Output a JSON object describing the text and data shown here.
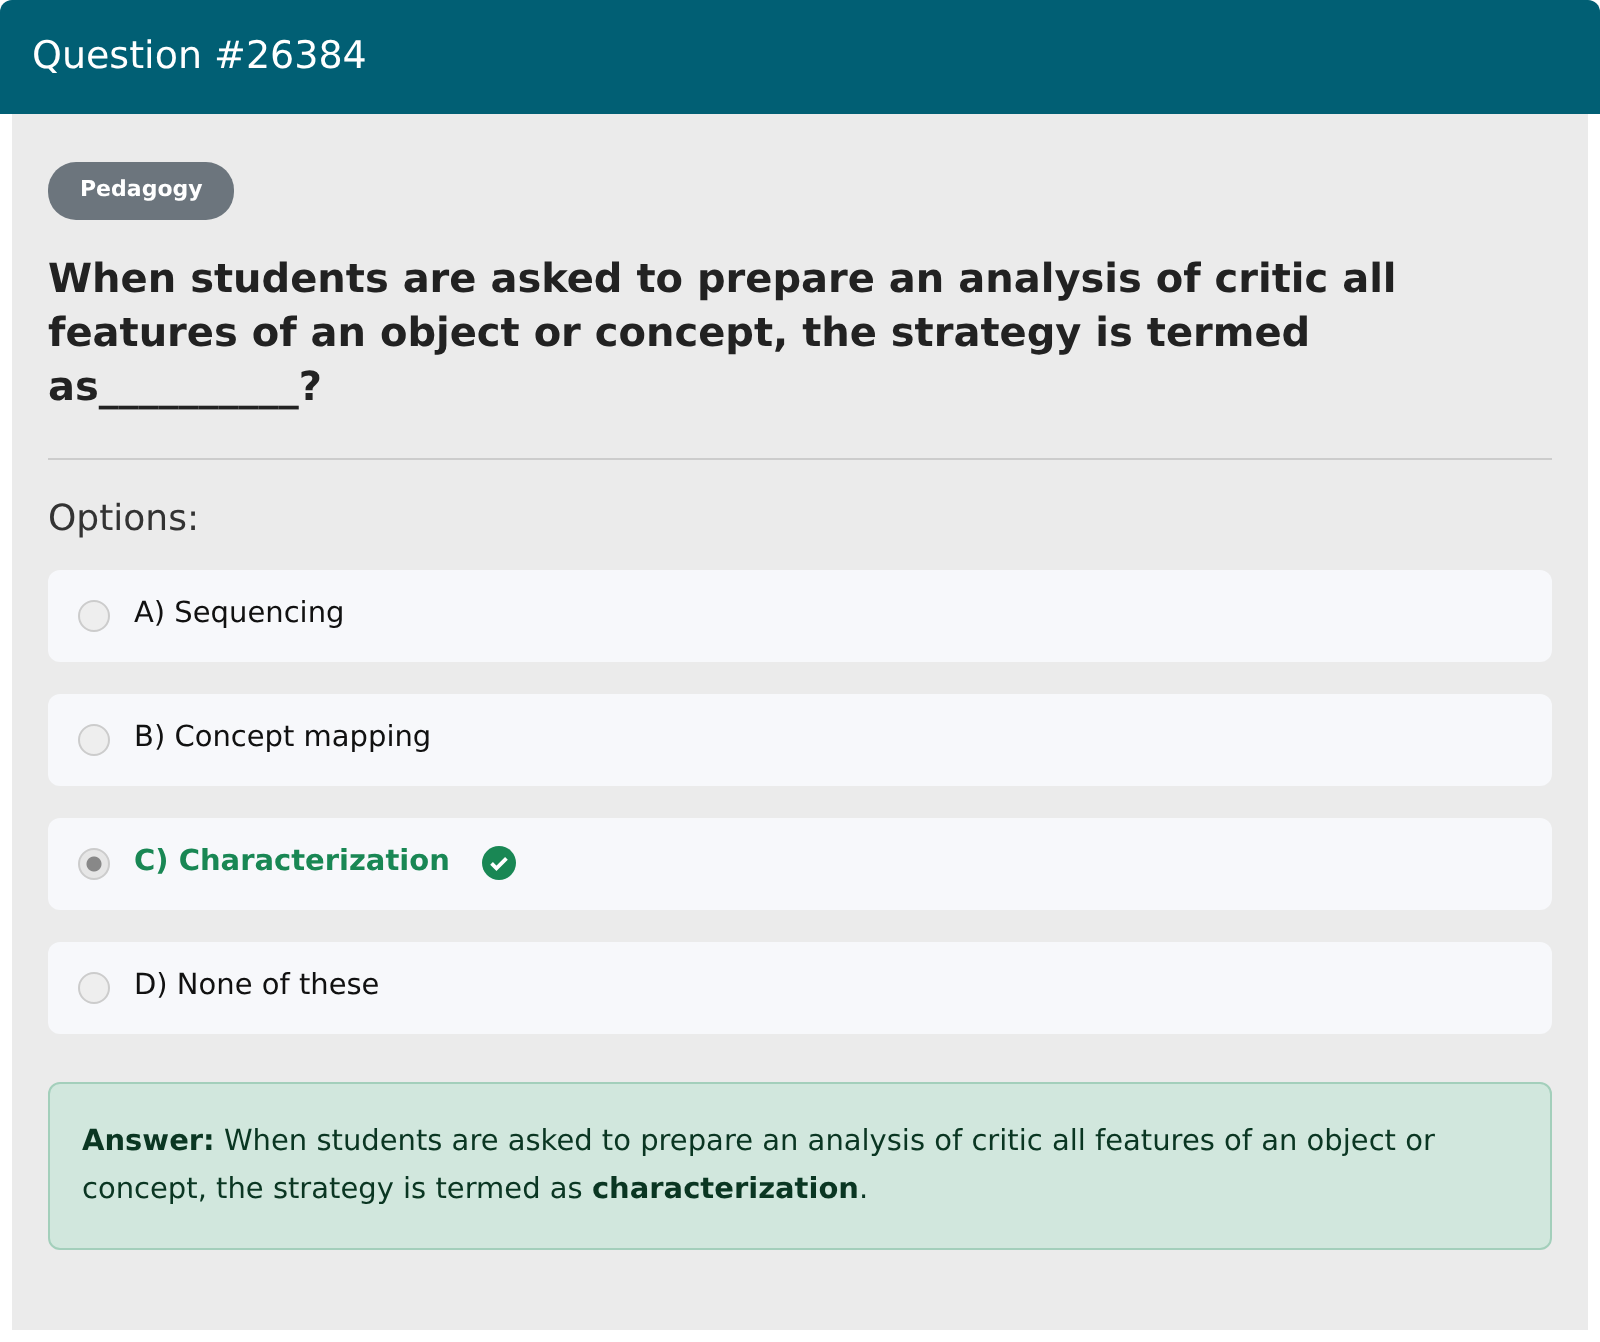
{
  "header": {
    "title": "Question #26384"
  },
  "category": "Pedagogy",
  "question": "When students are asked to prepare an analysis of critic all features of an object or concept, the strategy is termed as__________?",
  "options_label": "Options:",
  "options": [
    {
      "label": "A) Sequencing",
      "selected": false,
      "correct": false
    },
    {
      "label": "B) Concept mapping",
      "selected": false,
      "correct": false
    },
    {
      "label": "C) Characterization",
      "selected": true,
      "correct": true
    },
    {
      "label": "D) None of these",
      "selected": false,
      "correct": false
    }
  ],
  "answer": "**Answer:** When students are asked to prepare an analysis of critic all features of an object or concept, the strategy is termed as **characterization**."
}
